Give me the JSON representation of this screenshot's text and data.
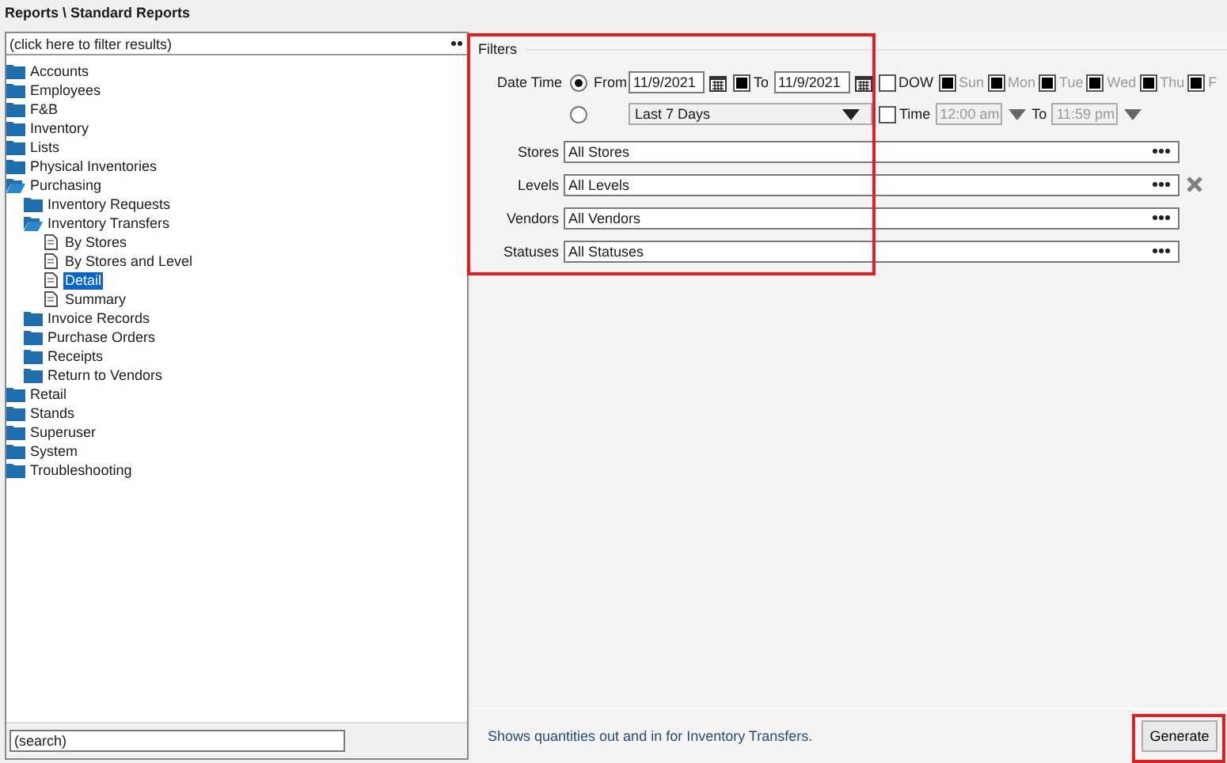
{
  "breadcrumb": "Reports \\ Standard Reports",
  "tree_filter": {
    "value": "(click here to filter results)"
  },
  "tree": [
    {
      "label": "Accounts",
      "kind": "folder",
      "expanded": false,
      "selected": false
    },
    {
      "label": "Employees",
      "kind": "folder",
      "expanded": false,
      "selected": false
    },
    {
      "label": "F&B",
      "kind": "folder",
      "expanded": false,
      "selected": false
    },
    {
      "label": "Inventory",
      "kind": "folder",
      "expanded": false,
      "selected": false
    },
    {
      "label": "Lists",
      "kind": "folder",
      "expanded": false,
      "selected": false
    },
    {
      "label": "Physical Inventories",
      "kind": "folder",
      "expanded": false,
      "selected": false
    },
    {
      "label": "Purchasing",
      "kind": "folder",
      "expanded": true,
      "selected": false,
      "children": [
        {
          "label": "Inventory Requests",
          "kind": "folder",
          "expanded": false,
          "selected": false
        },
        {
          "label": "Inventory Transfers",
          "kind": "folder",
          "expanded": true,
          "selected": false,
          "children": [
            {
              "label": "By Stores",
              "kind": "report",
              "selected": false
            },
            {
              "label": "By Stores and Level",
              "kind": "report",
              "selected": false
            },
            {
              "label": "Detail",
              "kind": "report",
              "selected": true
            },
            {
              "label": "Summary",
              "kind": "report",
              "selected": false
            }
          ]
        },
        {
          "label": "Invoice Records",
          "kind": "folder",
          "expanded": false,
          "selected": false
        },
        {
          "label": "Purchase Orders",
          "kind": "folder",
          "expanded": false,
          "selected": false
        },
        {
          "label": "Receipts",
          "kind": "folder",
          "expanded": false,
          "selected": false
        },
        {
          "label": "Return to Vendors",
          "kind": "folder",
          "expanded": false,
          "selected": false
        }
      ]
    },
    {
      "label": "Retail",
      "kind": "folder",
      "expanded": false,
      "selected": false
    },
    {
      "label": "Stands",
      "kind": "folder",
      "expanded": false,
      "selected": false
    },
    {
      "label": "Superuser",
      "kind": "folder",
      "expanded": false,
      "selected": false
    },
    {
      "label": "System",
      "kind": "folder",
      "expanded": false,
      "selected": false
    },
    {
      "label": "Troubleshooting",
      "kind": "folder",
      "expanded": false,
      "selected": false
    }
  ],
  "search": {
    "value": "(search)"
  },
  "filters": {
    "title": "Filters",
    "date_time": {
      "label": "Date Time",
      "range": {
        "selected": true,
        "from_label": "From",
        "from": "11/9/2021",
        "to_checked": true,
        "to_label": "To",
        "to": "11/9/2021"
      },
      "preset": {
        "selected": false,
        "value": "Last 7 Days"
      },
      "dow": {
        "label": "DOW",
        "checked": false
      },
      "days": [
        {
          "label": "Sun",
          "checked": true,
          "disabled": true
        },
        {
          "label": "Mon",
          "checked": true,
          "disabled": true
        },
        {
          "label": "Tue",
          "checked": true,
          "disabled": true
        },
        {
          "label": "Wed",
          "checked": true,
          "disabled": true
        },
        {
          "label": "Thu",
          "checked": true,
          "disabled": true
        },
        {
          "label": "F",
          "checked": true,
          "disabled": true
        }
      ],
      "time": {
        "label": "Time",
        "checked": false,
        "disabled": true,
        "from": "12:00 am",
        "to_label": "To",
        "to": "11:59 pm"
      }
    },
    "fields": [
      {
        "label": "Stores",
        "value": "All Stores",
        "clearable": false
      },
      {
        "label": "Levels",
        "value": "All Levels",
        "clearable": true
      },
      {
        "label": "Vendors",
        "value": "All Vendors",
        "clearable": false
      },
      {
        "label": "Statuses",
        "value": "All Statuses",
        "clearable": false
      }
    ]
  },
  "description": "Shows quantities out and in for Inventory Transfers.",
  "generate_button": "Generate"
}
